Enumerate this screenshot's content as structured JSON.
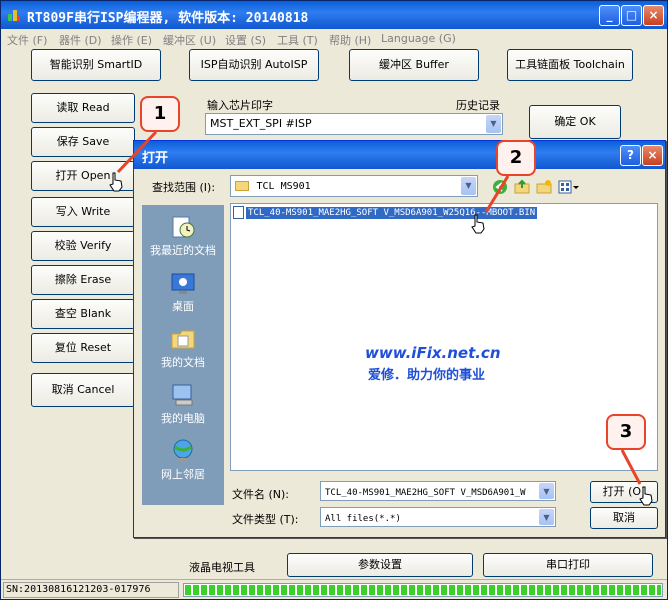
{
  "window": {
    "title": "RT809F串行ISP编程器, 软件版本: 20140818",
    "controls": [
      "_",
      "□",
      "×"
    ]
  },
  "menu": [
    "文件 (F)",
    "器件 (D)",
    "操作 (E)",
    "缓冲区 (U)",
    "设置 (S)",
    "工具 (T)",
    "帮助 (H)",
    "Language (G)"
  ],
  "toolbar": {
    "smart_id": "智能识别 SmartID",
    "auto_isp": "ISP自动识别 AutoISP",
    "buffer": "缓冲区 Buffer",
    "toolchain": "工具链面板 Toolchain"
  },
  "side_buttons": [
    "读取 Read",
    "保存 Save",
    "打开 Open",
    "写入 Write",
    "校验 Verify",
    "擦除 Erase",
    "查空 Blank",
    "复位 Reset",
    "取消 Cancel"
  ],
  "chip": {
    "label": "输入芯片印字",
    "history_label": "历史记录",
    "value": "MST_EXT_SPI #ISP",
    "ok": "确定 OK"
  },
  "bottom": {
    "lcd_tool": "液晶电视工具",
    "params": "参数设置",
    "serial_print": "串口打印"
  },
  "status": {
    "sn": "SN:20130816121203-017976",
    "progress": 1.0
  },
  "dialog": {
    "title": "打开",
    "look_in_label": "查找范围 (I):",
    "look_in_value": "TCL MS901",
    "places": [
      "我最近的文档",
      "桌面",
      "我的文档",
      "我的电脑",
      "网上邻居"
    ],
    "file": "TCL_40-MS901_MAE2HG_SOFT V_MSD6A901_W25Q16--MBOOT.BIN",
    "watermark_url": "www.iFix.net.cn",
    "watermark_slogan": "爱修．助力你的事业",
    "filename_label": "文件名 (N):",
    "filename_value": "TCL_40-MS901_MAE2HG_SOFT V_MSD6A901_W",
    "filetype_label": "文件类型 (T):",
    "filetype_value": "All files(*.*)",
    "open_btn": "打开 (O)",
    "cancel_btn": "取消"
  },
  "callouts": [
    "1",
    "2",
    "3"
  ],
  "colors": {
    "title_blue": "#1157d0",
    "callout_border": "#e8442a",
    "progress_green": "#3bcf2a",
    "selection": "#316ac5"
  }
}
